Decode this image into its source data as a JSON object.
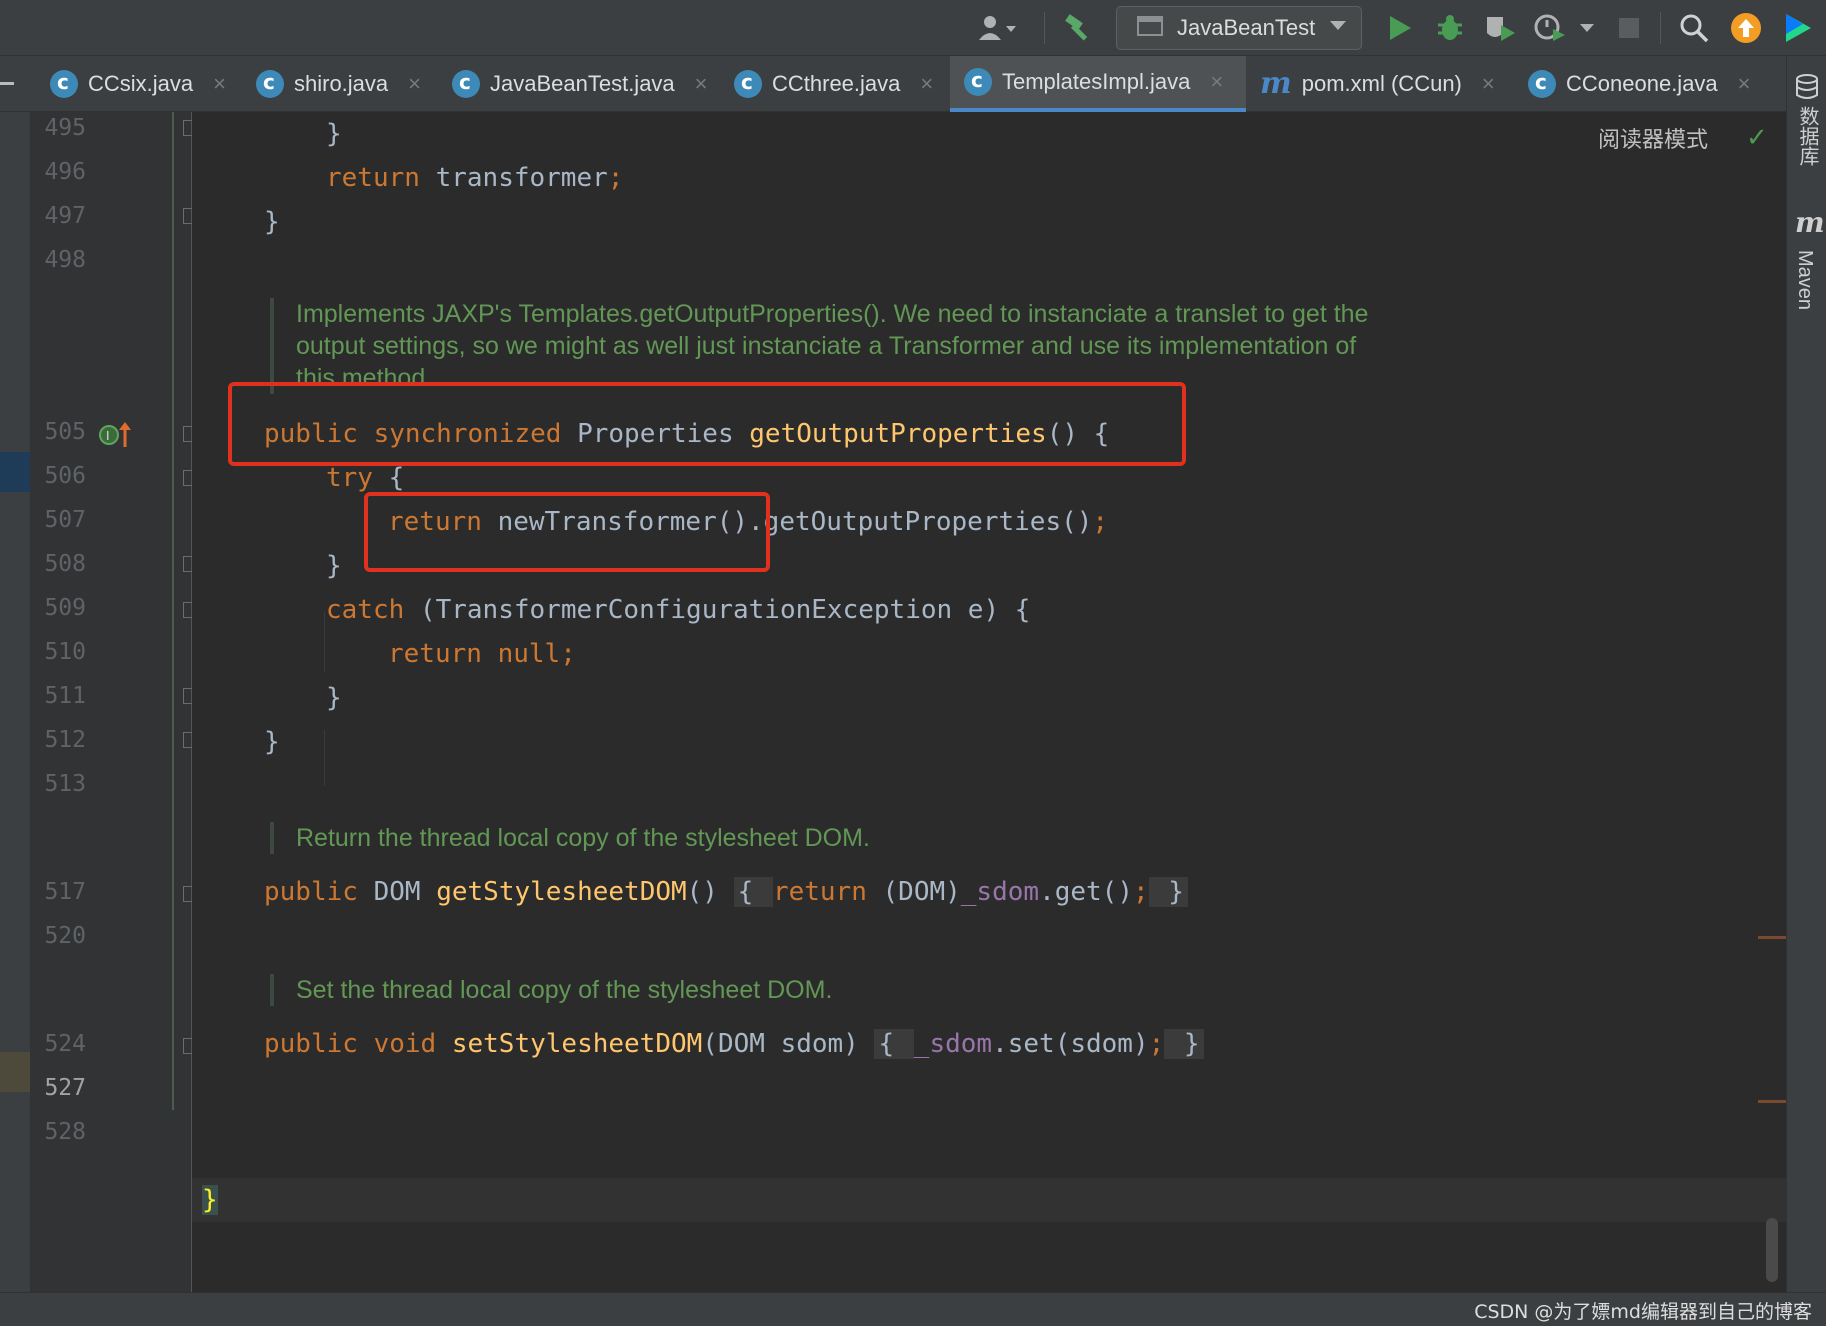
{
  "toolbar": {
    "run_config": "JavaBeanTest",
    "icons": [
      "user-icon",
      "build-hammer-icon",
      "run-icon",
      "debug-icon",
      "coverage-icon",
      "profiler-icon",
      "stop-icon",
      "search-icon",
      "update-icon",
      "jetbrains-logo-icon"
    ]
  },
  "tabs": [
    {
      "label": "CCsix.java",
      "close": "×",
      "icon": "class-icon"
    },
    {
      "label": "shiro.java",
      "close": "×",
      "icon": "class-icon"
    },
    {
      "label": "JavaBeanTest.java",
      "close": "×",
      "icon": "class-icon"
    },
    {
      "label": "CCthree.java",
      "close": "×",
      "icon": "class-icon"
    },
    {
      "label": "TemplatesImpl.java",
      "close": "×",
      "icon": "class-locked-icon",
      "active": true
    },
    {
      "label": "pom.xml (CCun)",
      "close": "×",
      "icon": "maven-icon"
    },
    {
      "label": "CConeone.java",
      "close": "×",
      "icon": "class-icon"
    }
  ],
  "sidebar": {
    "database": "数据库",
    "maven_icon": "m",
    "maven": "Maven"
  },
  "editor": {
    "reader_mode": "阅读器模式",
    "check": "✓",
    "line_numbers": [
      "495",
      "496",
      "497",
      "498",
      "505",
      "506",
      "507",
      "508",
      "509",
      "510",
      "511",
      "512",
      "513",
      "517",
      "520",
      "524",
      "527",
      "528"
    ],
    "current_line": "527",
    "code": {
      "l495": "}",
      "l496_kw": "return",
      "l496_rest": " transformer",
      "l496_semi": ";",
      "l497": "}",
      "doc1_line1": "Implements JAXP's Templates.getOutputProperties(). We need to instanciate a translet to get the",
      "doc1_line2": "output settings, so we might as well just instanciate a Transformer and use its implementation of",
      "doc1_line3": "this method.",
      "l505_kw": "public synchronized",
      "l505_type": " Properties ",
      "l505_fn": "getOutputProperties",
      "l505_rest": "() {",
      "l506_kw": "try",
      "l506_rest": " {",
      "l507_kw": "return",
      "l507_rest": " newTransformer().getOutputProperties()",
      "l507_semi": ";",
      "l508": "}",
      "l509_kw": "catch",
      "l509_rest": " (TransformerConfigurationException e) {",
      "l510_kw": "return null",
      "l510_semi": ";",
      "l511": "}",
      "l512": "}",
      "doc2": "Return the thread local copy of the stylesheet DOM.",
      "l517_kw": "public",
      "l517_type": " DOM ",
      "l517_fn": "getStylesheetDOM",
      "l517_paren": "() ",
      "l517_b1": "{ ",
      "l517_kw2": "return",
      "l517_cast": " (DOM)",
      "l517_field": "_sdom",
      "l517_call": ".get()",
      "l517_semi": ";",
      "l517_b2": " }",
      "doc3": "Set the thread local copy of the stylesheet DOM.",
      "l524_kw": "public void",
      "l524_fn": " setStylesheetDOM",
      "l524_params": "(DOM sdom) ",
      "l524_b1": "{ ",
      "l524_field": "_sdom",
      "l524_call": ".set(sdom)",
      "l524_semi": ";",
      "l524_b2": " }",
      "l527": "}"
    }
  },
  "status": {
    "watermark": "CSDN @为了嫖md编辑器到自己的博客"
  }
}
